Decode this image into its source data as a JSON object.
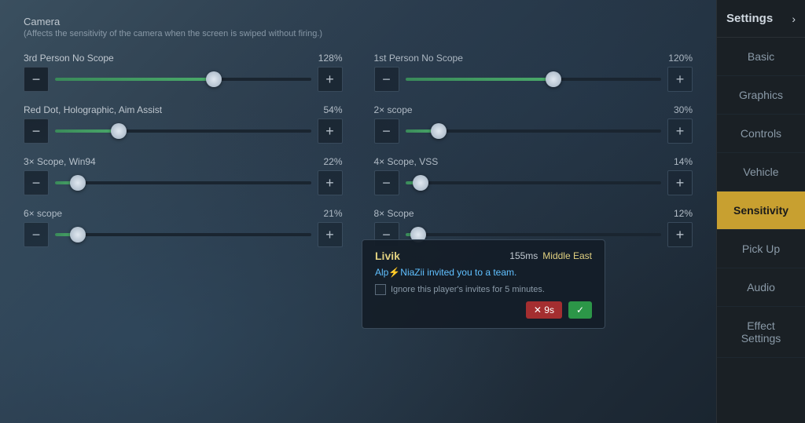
{
  "sidebar": {
    "title": "Settings",
    "arrow": "›",
    "items": [
      {
        "label": "Basic",
        "active": false
      },
      {
        "label": "Graphics",
        "active": false
      },
      {
        "label": "Controls",
        "active": false
      },
      {
        "label": "Vehicle",
        "active": false
      },
      {
        "label": "Sensitivity",
        "active": true
      },
      {
        "label": "Pick Up",
        "active": false
      },
      {
        "label": "Audio",
        "active": false
      },
      {
        "label": "Effect Settings",
        "active": false
      }
    ]
  },
  "camera": {
    "label": "Camera",
    "description": "(Affects the sensitivity of the camera when the screen is swiped without firing.)"
  },
  "sliders": [
    {
      "name": "3rd Person No Scope",
      "value": "128%",
      "percent": 62,
      "thumbPos": 62
    },
    {
      "name": "1st Person No Scope",
      "value": "120%",
      "percent": 58,
      "thumbPos": 58
    },
    {
      "name": "Red Dot, Holographic, Aim Assist",
      "value": "54%",
      "percent": 25,
      "thumbPos": 25
    },
    {
      "name": "2× scope",
      "value": "30%",
      "percent": 13,
      "thumbPos": 13
    },
    {
      "name": "3× Scope, Win94",
      "value": "22%",
      "percent": 9,
      "thumbPos": 9
    },
    {
      "name": "4× Scope, VSS",
      "value": "14%",
      "percent": 6,
      "thumbPos": 6
    },
    {
      "name": "6× scope",
      "value": "21%",
      "percent": 9,
      "thumbPos": 9
    },
    {
      "name": "8× Scope",
      "value": "12%",
      "percent": 5,
      "thumbPos": 5
    }
  ],
  "notification": {
    "map": "Livik",
    "ping": "155ms",
    "region": "Middle East",
    "inviter": "Alp⚡NiaZii",
    "message": " invited you to a team.",
    "ignore_label": "Ignore this player's invites for 5 minutes.",
    "decline_label": "✕ 9s",
    "accept_label": "✓"
  }
}
